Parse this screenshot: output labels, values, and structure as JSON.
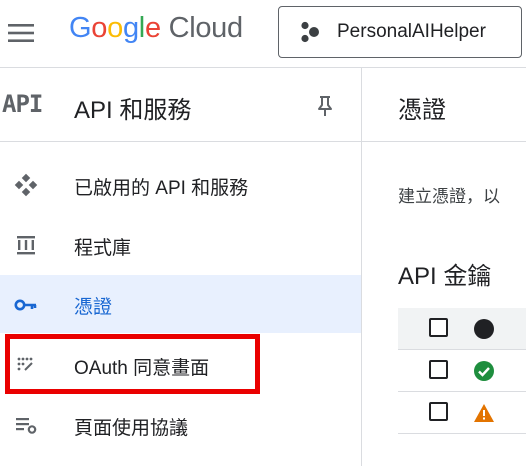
{
  "header": {
    "logo_google": "Google",
    "logo_cloud": "Cloud",
    "project_name": "PersonalAIHelper"
  },
  "sidebar": {
    "logo_text": "API",
    "title": "API 和服務",
    "items": [
      {
        "label": "已啟用的 API 和服務",
        "icon": "diamond-dots-icon"
      },
      {
        "label": "程式庫",
        "icon": "library-icon"
      },
      {
        "label": "憑證",
        "icon": "key-icon",
        "active": true
      },
      {
        "label": "OAuth 同意畫面",
        "icon": "oauth-consent-icon",
        "highlighted": true
      },
      {
        "label": "頁面使用協議",
        "icon": "settings-list-icon"
      }
    ]
  },
  "main": {
    "title": "憑證",
    "description": "建立憑證，以",
    "section_title": "API 金鑰",
    "rows": [
      {
        "status": "check-circle-icon"
      },
      {
        "status": "warning-icon"
      }
    ]
  },
  "colors": {
    "active_bg": "#e8f0fe",
    "active_text": "#1967d2",
    "highlight_border": "#ea0000",
    "status_ok": "#1e8e3e",
    "status_warn": "#e37400"
  }
}
